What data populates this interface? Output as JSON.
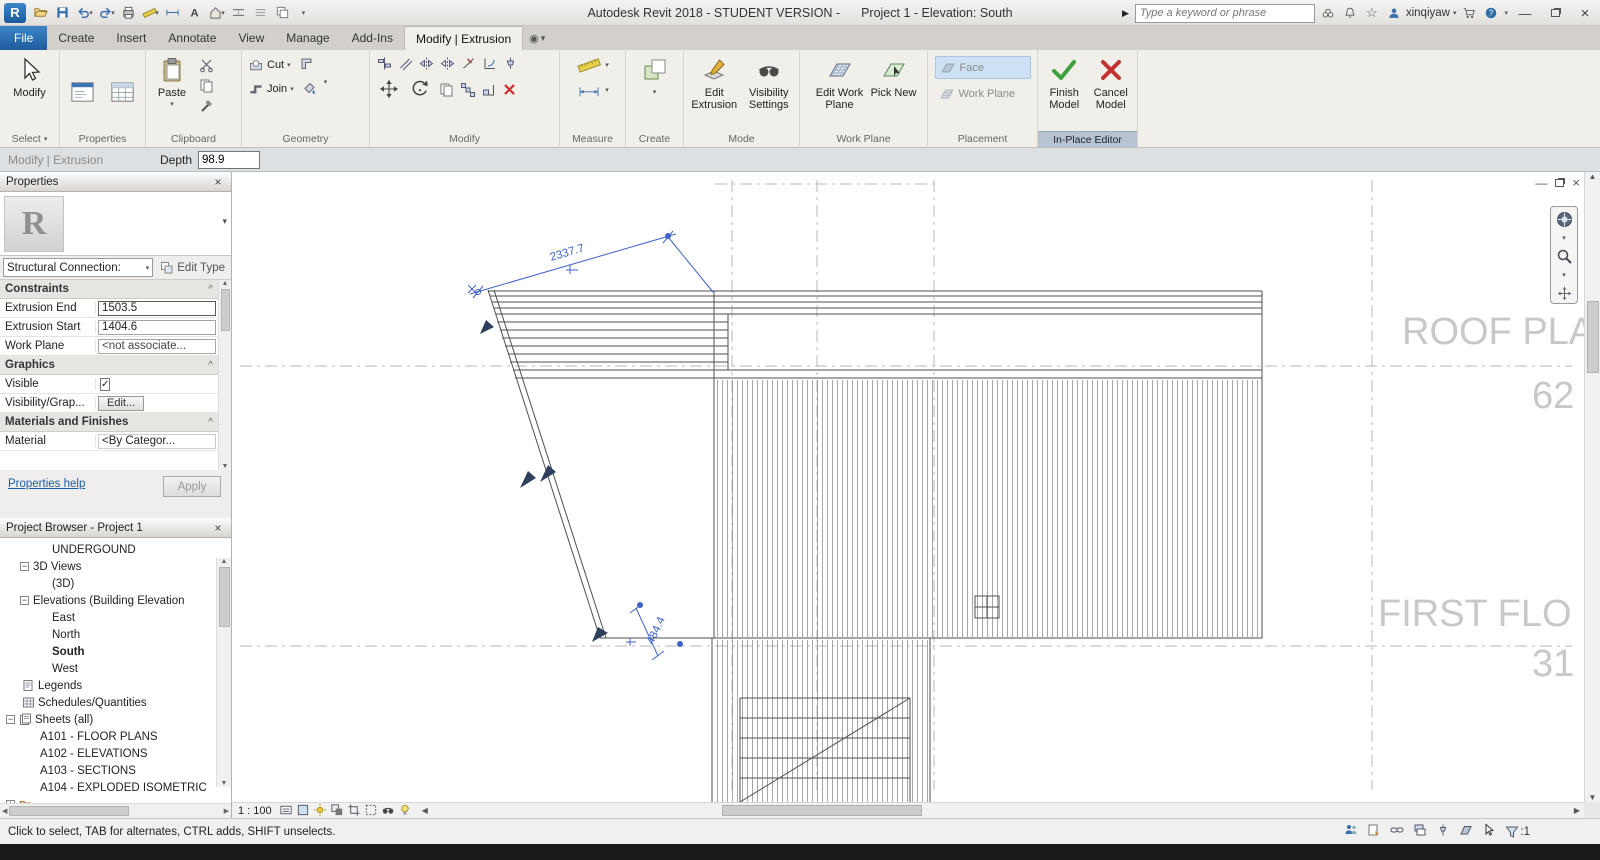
{
  "titlebar": {
    "app_title": "Autodesk Revit 2018 - STUDENT VERSION -",
    "doc_title": "Project 1 - Elevation: South",
    "search_placeholder": "Type a keyword or phrase",
    "username": "xinqiyaw"
  },
  "tabs": {
    "file": "File",
    "create": "Create",
    "insert": "Insert",
    "annotate": "Annotate",
    "view": "View",
    "manage": "Manage",
    "addins": "Add-Ins",
    "modify_context": "Modify | Extrusion"
  },
  "ribbon": {
    "select": {
      "modify": "Modify",
      "label": "Select"
    },
    "properties": {
      "label": "Properties"
    },
    "clipboard": {
      "paste": "Paste",
      "label": "Clipboard"
    },
    "geometry": {
      "cut": "Cut",
      "join": "Join",
      "label": "Geometry"
    },
    "modify_panel": {
      "label": "Modify"
    },
    "measure": {
      "label": "Measure"
    },
    "create": {
      "label": "Create"
    },
    "mode": {
      "edit_extrusion": "Edit Extrusion",
      "visibility_settings": "Visibility Settings",
      "label": "Mode"
    },
    "work_plane": {
      "edit_work_plane": "Edit Work Plane",
      "pick_new": "Pick New",
      "label": "Work Plane"
    },
    "placement": {
      "face": "Face",
      "work_plane": "Work Plane",
      "label": "Placement"
    },
    "in_place": {
      "finish": "Finish Model",
      "cancel": "Cancel Model",
      "label": "In-Place Editor"
    }
  },
  "options_bar": {
    "context": "Modify | Extrusion",
    "depth_label": "Depth",
    "depth_value": "98.9"
  },
  "properties_panel": {
    "title": "Properties",
    "type_name": "Structural Connection:",
    "edit_type": "Edit Type",
    "constraints": {
      "header": "Constraints",
      "rows": [
        {
          "label": "Extrusion End",
          "value": "1503.5"
        },
        {
          "label": "Extrusion Start",
          "value": "1404.6"
        },
        {
          "label": "Work Plane",
          "value": "<not associate..."
        }
      ]
    },
    "graphics": {
      "header": "Graphics",
      "visible_label": "Visible",
      "visibility_label": "Visibility/Grap...",
      "visibility_button": "Edit..."
    },
    "materials": {
      "header": "Materials and Finishes",
      "material_label": "Material",
      "material_value": "<By Categor..."
    },
    "help_link": "Properties help",
    "apply": "Apply"
  },
  "browser": {
    "title": "Project Browser - Project 1",
    "items": [
      {
        "label": "UNDERGOUND"
      },
      {
        "label": "3D Views"
      },
      {
        "label": "(3D)"
      },
      {
        "label": "Elevations (Building Elevation"
      },
      {
        "label": "East"
      },
      {
        "label": "North"
      },
      {
        "label": "South"
      },
      {
        "label": "West"
      },
      {
        "label": "Legends"
      },
      {
        "label": "Schedules/Quantities"
      },
      {
        "label": "Sheets (all)"
      },
      {
        "label": "A101 - FLOOR PLANS"
      },
      {
        "label": "A102 - ELEVATIONS"
      },
      {
        "label": "A103 - SECTIONS"
      },
      {
        "label": "A104 - EXPLODED ISOMETRIC"
      }
    ]
  },
  "canvas": {
    "dim_main": "2337.7",
    "dim_small": "484.4",
    "roof_label": "ROOF PLA",
    "roof_value": "62",
    "first_label": "FIRST FLO",
    "first_value": "31",
    "scale": "1 : 100"
  },
  "status": {
    "message": "Click to select, TAB for alternates, CTRL adds, SHIFT unselects.",
    "filter_count": ":1"
  }
}
